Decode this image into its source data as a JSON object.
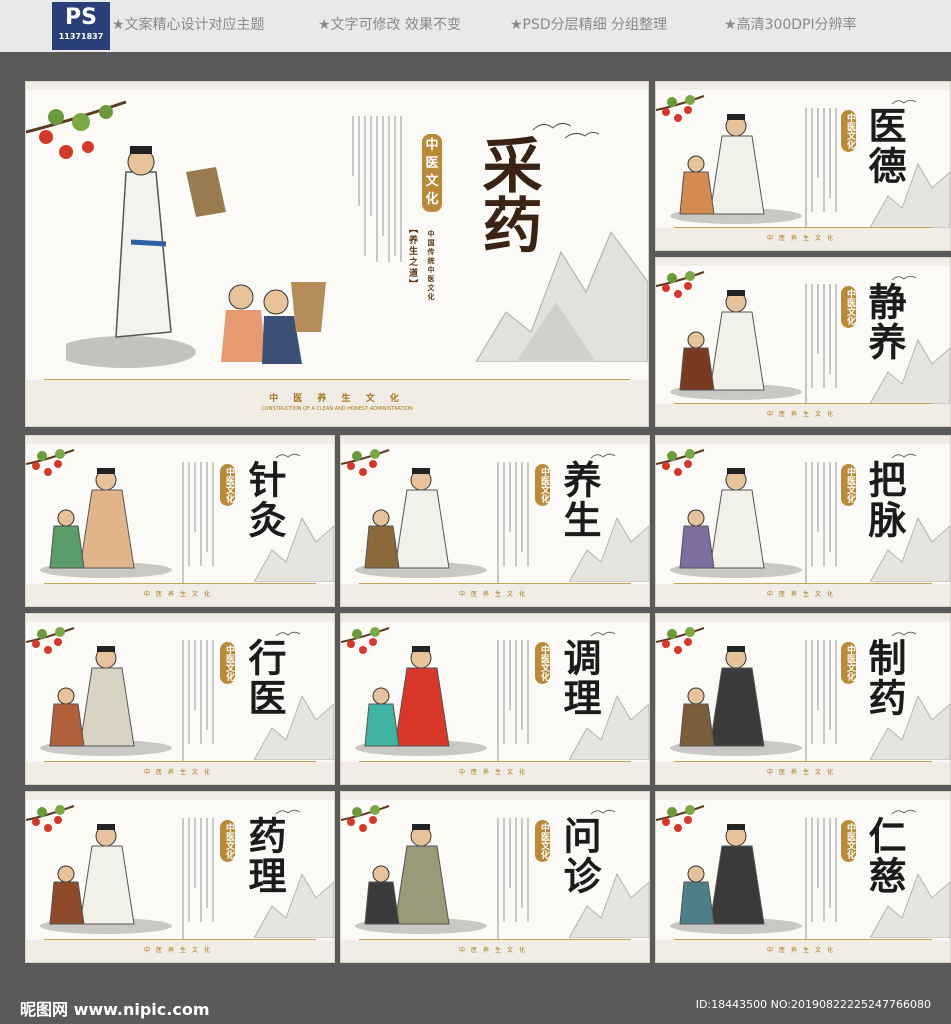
{
  "header": {
    "badge_title": "PS",
    "badge_number": "11371837",
    "features": [
      "★文案精心设计对应主题",
      "★文字可修改 效果不变",
      "★PSD分层精细 分组整理",
      "★高清300DPI分辨率"
    ]
  },
  "main_panel": {
    "title": "采药",
    "seal": "中医文化",
    "bracket": "【养生之道】",
    "side_caption": "中国传统中医文化",
    "footer_cn": "中 医 养 生 文 化",
    "footer_en": "CONSTRUCTION OF A CLEAN AND HONEST ADMINISTRATION"
  },
  "panels": [
    {
      "title": "医德",
      "seal": "中医文化"
    },
    {
      "title": "静养",
      "seal": "中医文化"
    },
    {
      "title": "针灸",
      "seal": "中医文化"
    },
    {
      "title": "养生",
      "seal": "中医文化"
    },
    {
      "title": "把脉",
      "seal": "中医文化"
    },
    {
      "title": "行医",
      "seal": "中医文化"
    },
    {
      "title": "调理",
      "seal": "中医文化"
    },
    {
      "title": "制药",
      "seal": "中医文化"
    },
    {
      "title": "药理",
      "seal": "中医文化"
    },
    {
      "title": "问诊",
      "seal": "中医文化"
    },
    {
      "title": "仁慈",
      "seal": "中医文化"
    }
  ],
  "panel_footer": "中医养生文化",
  "watermark": {
    "left": "昵图网 www.nipic.com",
    "right": "ID:18443500 NO:20190822225247766080"
  },
  "colors": {
    "gold": "#a6751b",
    "paper": "#fbfaf7",
    "badge": "#2a3f78"
  }
}
